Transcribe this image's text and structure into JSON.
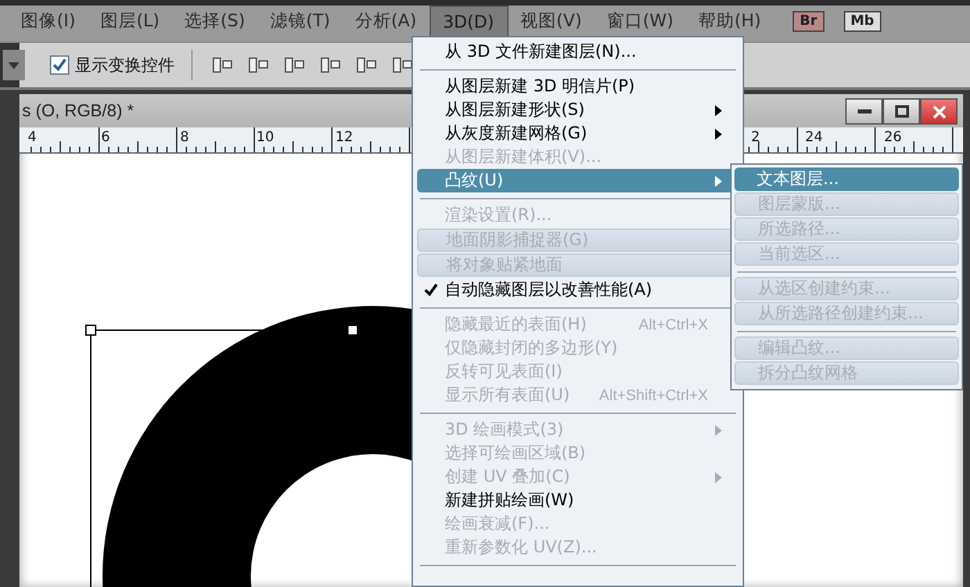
{
  "menu_bar": [
    {
      "label": "图像(I)",
      "selected": false
    },
    {
      "label": "图层(L)",
      "selected": false
    },
    {
      "label": "选择(S)",
      "selected": false
    },
    {
      "label": "滤镜(T)",
      "selected": false
    },
    {
      "label": "分析(A)",
      "selected": false
    },
    {
      "label": "3D(D)",
      "selected": true
    },
    {
      "label": "视图(V)",
      "selected": false
    },
    {
      "label": "窗口(W)",
      "selected": false
    },
    {
      "label": "帮助(H)",
      "selected": false
    }
  ],
  "app_buttons": [
    "Br",
    "Mb"
  ],
  "toolbar": {
    "checkbox": {
      "label": "显示变换控件",
      "checked": true
    }
  },
  "document": {
    "title": "s (O, RGB/8) *",
    "ruler_labels": [
      "4",
      "6",
      "8",
      "10",
      "12",
      "2",
      "24",
      "26"
    ]
  },
  "menu": [
    {
      "kind": "item",
      "label": "从 3D 文件新建图层(N)...",
      "disabled": false
    },
    {
      "kind": "separator"
    },
    {
      "kind": "item",
      "label": "从图层新建 3D 明信片(P)",
      "disabled": false
    },
    {
      "kind": "item",
      "label": "从图层新建形状(S)",
      "disabled": false,
      "submenu": true
    },
    {
      "kind": "item",
      "label": "从灰度新建网格(G)",
      "disabled": false,
      "submenu": true
    },
    {
      "kind": "item",
      "label": "从图层新建体积(V)...",
      "disabled": true
    },
    {
      "kind": "item",
      "label": "凸纹(U)",
      "disabled": false,
      "submenu": true,
      "selected": true
    },
    {
      "kind": "separator"
    },
    {
      "kind": "item",
      "label": "渲染设置(R)...",
      "disabled": true
    },
    {
      "kind": "item",
      "label": "地面阴影捕捉器(G)",
      "disabled": true,
      "shaded": true
    },
    {
      "kind": "item",
      "label": "将对象贴紧地面",
      "disabled": true,
      "shaded": true
    },
    {
      "kind": "item",
      "label": "自动隐藏图层以改善性能(A)",
      "disabled": false,
      "checked": true
    },
    {
      "kind": "separator"
    },
    {
      "kind": "item",
      "label": "隐藏最近的表面(H)",
      "shortcut": "Alt+Ctrl+X",
      "disabled": true
    },
    {
      "kind": "item",
      "label": "仅隐藏封闭的多边形(Y)",
      "disabled": true
    },
    {
      "kind": "item",
      "label": "反转可见表面(I)",
      "disabled": true
    },
    {
      "kind": "item",
      "label": "显示所有表面(U)",
      "shortcut": "Alt+Shift+Ctrl+X",
      "disabled": true
    },
    {
      "kind": "separator"
    },
    {
      "kind": "item",
      "label": "3D 绘画模式(3)",
      "disabled": true,
      "submenu": true
    },
    {
      "kind": "item",
      "label": "选择可绘画区域(B)",
      "disabled": true
    },
    {
      "kind": "item",
      "label": "创建 UV 叠加(C)",
      "disabled": true,
      "submenu": true
    },
    {
      "kind": "item",
      "label": "新建拼贴绘画(W)",
      "disabled": false
    },
    {
      "kind": "item",
      "label": "绘画衰减(F)...",
      "disabled": true
    },
    {
      "kind": "item",
      "label": "重新参数化 UV(Z)...",
      "disabled": true
    },
    {
      "kind": "separator"
    }
  ],
  "submenu": [
    {
      "kind": "item",
      "label": "文本图层...",
      "disabled": false,
      "selected": true
    },
    {
      "kind": "item",
      "label": "图层蒙版...",
      "disabled": true,
      "shaded": true
    },
    {
      "kind": "item",
      "label": "所选路径...",
      "disabled": true,
      "shaded": true
    },
    {
      "kind": "item",
      "label": "当前选区...",
      "disabled": true,
      "shaded": true
    },
    {
      "kind": "separator"
    },
    {
      "kind": "item",
      "label": "从选区创建约束...",
      "disabled": true,
      "shaded": true
    },
    {
      "kind": "item",
      "label": "从所选路径创建约束...",
      "disabled": true,
      "shaded": true
    },
    {
      "kind": "separator"
    },
    {
      "kind": "item",
      "label": "编辑凸纹...",
      "disabled": true,
      "shaded": true
    },
    {
      "kind": "item",
      "label": "拆分凸纹网格",
      "disabled": true,
      "shaded": true
    }
  ]
}
